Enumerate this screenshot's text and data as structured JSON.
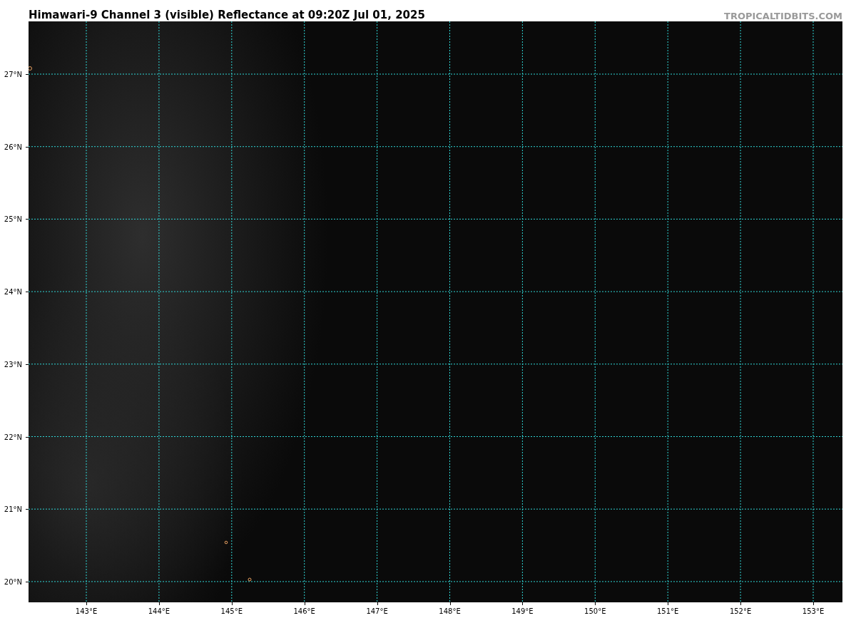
{
  "title": "Himawari-9 Channel 3 (visible) Reflectance at 09:20Z Jul 01, 2025",
  "credit": "TROPICALTIDBITS.COM",
  "map": {
    "lat_labels": [
      "27°N",
      "26°N",
      "25°N",
      "24°N",
      "23°N",
      "22°N",
      "21°N",
      "20°N"
    ],
    "lon_labels": [
      "143°E",
      "144°E",
      "145°E",
      "146°E",
      "147°E",
      "148°E",
      "149°E",
      "150°E",
      "151°E",
      "152°E",
      "153°E"
    ]
  }
}
